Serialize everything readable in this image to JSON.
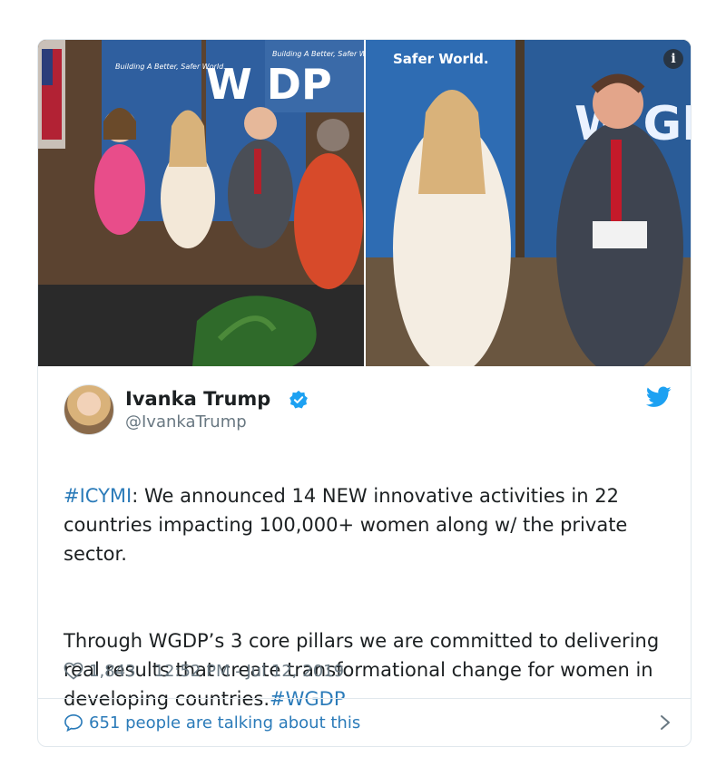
{
  "tweet": {
    "author_name": "Ivanka Trump",
    "handle": "@IvankaTrump",
    "text_p1_tag": "#ICYMI",
    "text_p1_rest": ": We announced 14 NEW innovative activities in 22 countries impacting 100,000+ women along w/ the private sector.",
    "text_p2_body": "Through WGDP’s 3 core pillars we are committed to delivering real results that create transformational change for women in developing countries.",
    "text_p2_tag": "#WGDP",
    "likes": "1,843",
    "timestamp": "12:52 PM - Jul 12, 2019",
    "talking": "651 people are talking about this"
  },
  "media": {
    "left_banner_1": "Building A Better, Safer World.",
    "left_banner_2": "Building A Better, Safer World.",
    "left_logo": "W DP",
    "right_banner": "Safer World.",
    "right_logo": "W GD"
  },
  "colors": {
    "link": "#2b7bb9",
    "muted": "#697882",
    "text": "#1c2022",
    "border": "#e1e8ed",
    "twitter_blue": "#1da1f2"
  },
  "icons": [
    "info-icon",
    "verified-badge-icon",
    "twitter-bird-icon",
    "heart-icon",
    "speech-bubble-icon",
    "chevron-right-icon"
  ]
}
